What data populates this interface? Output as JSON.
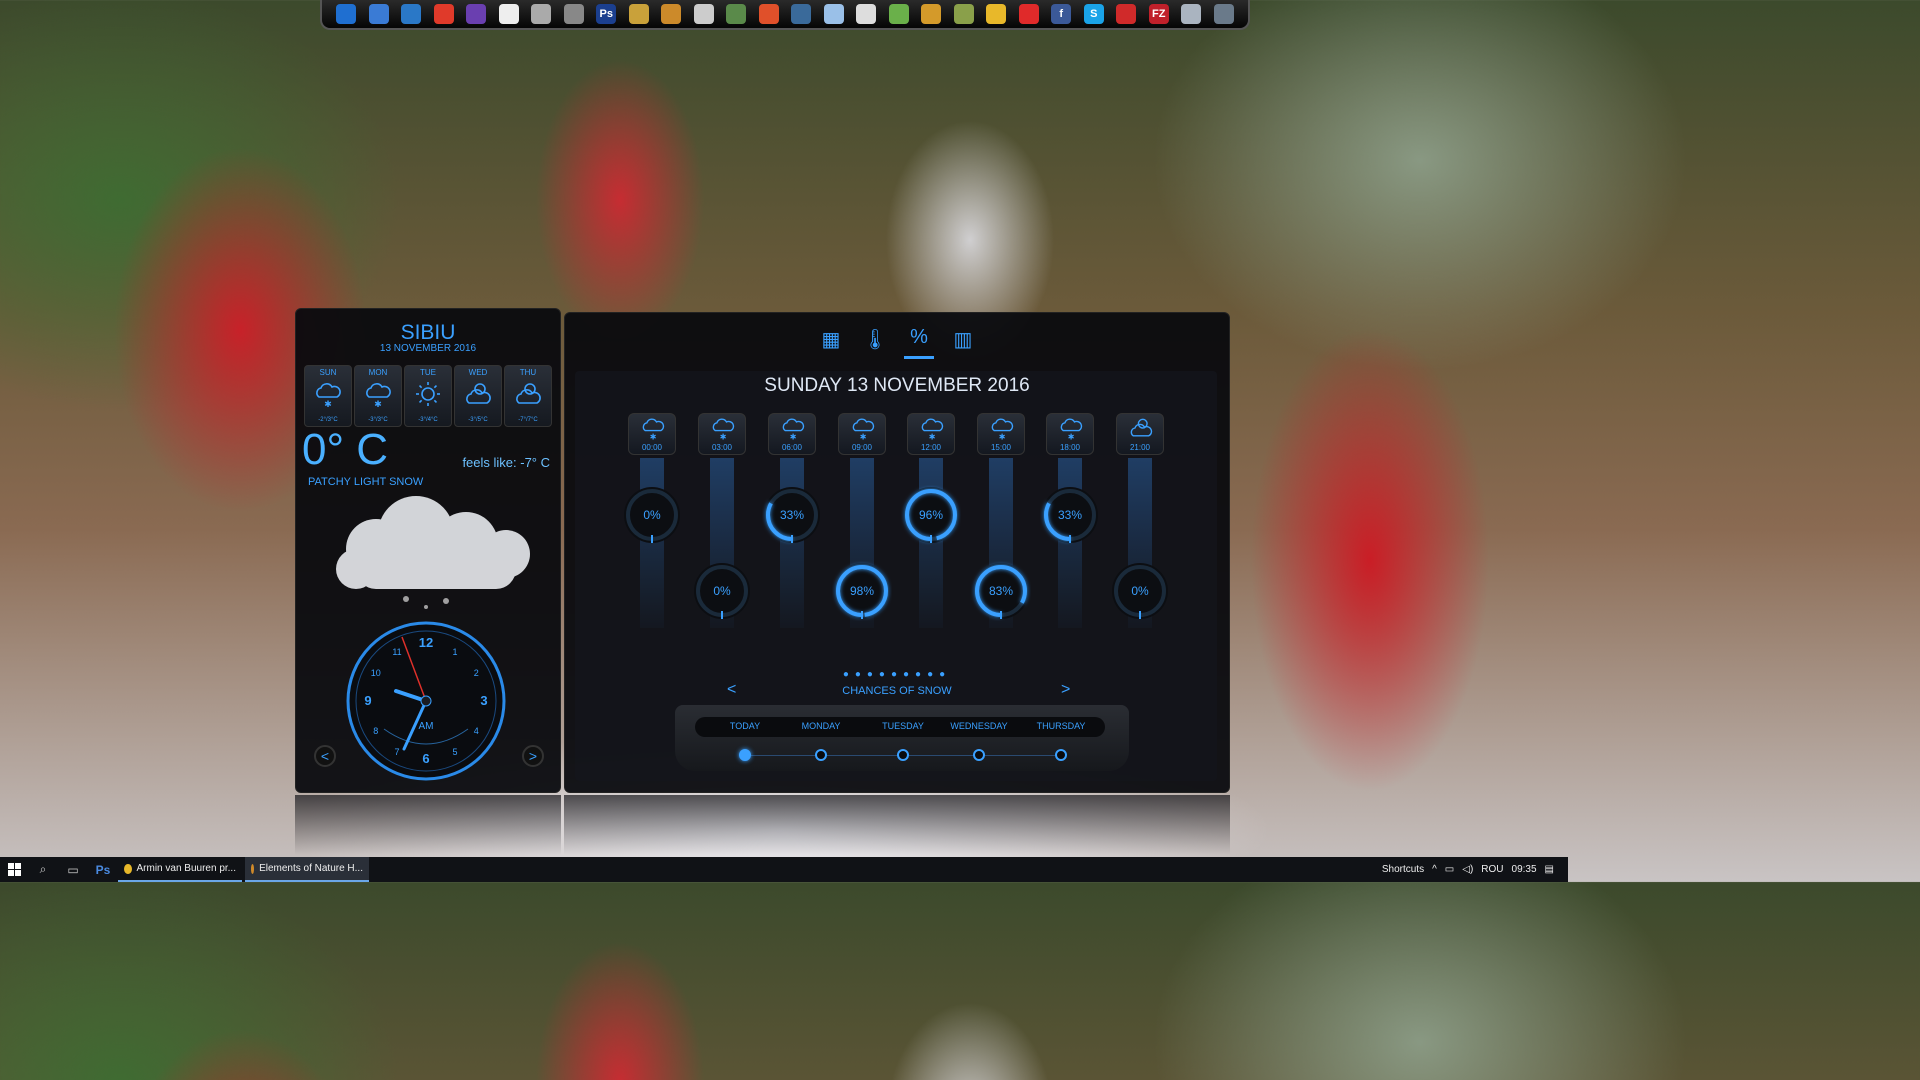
{
  "dock": {
    "icons": [
      {
        "name": "windows-icon",
        "color": "#1f6fd1"
      },
      {
        "name": "monitor-icon",
        "color": "#3a7bd5"
      },
      {
        "name": "swirl-icon",
        "color": "#2a78c7"
      },
      {
        "name": "alarm-icon",
        "color": "#e03a2a"
      },
      {
        "name": "visual-studio-icon",
        "color": "#6a3fb0"
      },
      {
        "name": "document-icon",
        "color": "#eeeeee"
      },
      {
        "name": "bird-icon",
        "color": "#aaaaaa"
      },
      {
        "name": "jet-icon",
        "color": "#888888"
      },
      {
        "name": "photoshop-icon",
        "color": "#1b3f8f"
      },
      {
        "name": "compass-icon",
        "color": "#c9a13a"
      },
      {
        "name": "film-icon",
        "color": "#cc8a2a"
      },
      {
        "name": "mouse-icon",
        "color": "#cccccc"
      },
      {
        "name": "globe-icon",
        "color": "#5a8a4a"
      },
      {
        "name": "gear-icon",
        "color": "#e0502a"
      },
      {
        "name": "steam-icon",
        "color": "#3a6a9a"
      },
      {
        "name": "cube-icon",
        "color": "#9ac0e8"
      },
      {
        "name": "feather-icon",
        "color": "#dddddd"
      },
      {
        "name": "notepad-icon",
        "color": "#6ab04a"
      },
      {
        "name": "winamp-icon",
        "color": "#d49a2a"
      },
      {
        "name": "map-icon",
        "color": "#8aa04a"
      },
      {
        "name": "chrome-icon",
        "color": "#e8b82a"
      },
      {
        "name": "youtube-icon",
        "color": "#e02a2a"
      },
      {
        "name": "facebook-icon",
        "color": "#3b5998"
      },
      {
        "name": "skype-icon",
        "color": "#1aa3e8"
      },
      {
        "name": "wifi-icon",
        "color": "#d02a2a"
      },
      {
        "name": "filezilla-icon",
        "color": "#c0202a"
      },
      {
        "name": "trash-icon",
        "color": "#aab4c0"
      },
      {
        "name": "camera-icon",
        "color": "#6a7a8a"
      }
    ],
    "labels": {
      "photoshop": "Ps",
      "filezilla": "FZ",
      "facebook": "f",
      "skype": "S"
    }
  },
  "weather": {
    "city": "SIBIU",
    "date": "13 NOVEMBER 2016",
    "days": [
      {
        "name": "SUN",
        "temp": "-2°/3°C",
        "icon": "snow"
      },
      {
        "name": "MON",
        "temp": "-3°/3°C",
        "icon": "snow"
      },
      {
        "name": "TUE",
        "temp": "-3°/4°C",
        "icon": "sun"
      },
      {
        "name": "WED",
        "temp": "-3°/5°C",
        "icon": "partly-cloudy"
      },
      {
        "name": "THU",
        "temp": "-7°/7°C",
        "icon": "partly-cloudy"
      }
    ],
    "current_temp": "0° C",
    "feels_like": "feels like: -7° C",
    "condition": "PATCHY LIGHT SNOW",
    "clock": {
      "numbers": [
        "12",
        "1",
        "2",
        "3",
        "4",
        "5",
        "6",
        "7",
        "8",
        "9",
        "10",
        "11"
      ],
      "ampm": "AM"
    },
    "nav": {
      "prev": "<",
      "next": ">"
    }
  },
  "forecast": {
    "tabs": [
      {
        "name": "tab-conditions",
        "glyph": "▦",
        "active": false
      },
      {
        "name": "tab-temperature",
        "glyph": "🌡",
        "active": false
      },
      {
        "name": "tab-percent",
        "glyph": "%",
        "active": true
      },
      {
        "name": "tab-chart",
        "glyph": "▥",
        "active": false
      }
    ],
    "heading": "SUNDAY 13 NOVEMBER 2016",
    "hours": [
      {
        "time": "00:00",
        "percent": "0%",
        "value": 0,
        "icon": "snow"
      },
      {
        "time": "03:00",
        "percent": "0%",
        "value": 0,
        "icon": "snow"
      },
      {
        "time": "06:00",
        "percent": "33%",
        "value": 33,
        "icon": "snow"
      },
      {
        "time": "09:00",
        "percent": "98%",
        "value": 98,
        "icon": "snow"
      },
      {
        "time": "12:00",
        "percent": "96%",
        "value": 96,
        "icon": "snow"
      },
      {
        "time": "15:00",
        "percent": "83%",
        "value": 83,
        "icon": "snow"
      },
      {
        "time": "18:00",
        "percent": "33%",
        "value": 33,
        "icon": "snow"
      },
      {
        "time": "21:00",
        "percent": "0%",
        "value": 0,
        "icon": "night-cloud"
      }
    ],
    "chances_label": "CHANCES OF SNOW",
    "prev": "<",
    "next": ">",
    "days": [
      "TODAY",
      "MONDAY",
      "TUESDAY",
      "WEDNESDAY",
      "THURSDAY"
    ],
    "active_day": 0
  },
  "taskbar": {
    "apps": [
      {
        "label": "Armin van Buuren pr...",
        "icon": "chrome-icon",
        "active": false
      },
      {
        "label": "Elements of Nature H...",
        "icon": "weather-icon",
        "active": true
      }
    ],
    "shortcuts": "Shortcuts",
    "language": "ROU",
    "time": "09:35"
  },
  "colors": {
    "accent": "#3aa0ff",
    "panel": "#080a0e"
  }
}
